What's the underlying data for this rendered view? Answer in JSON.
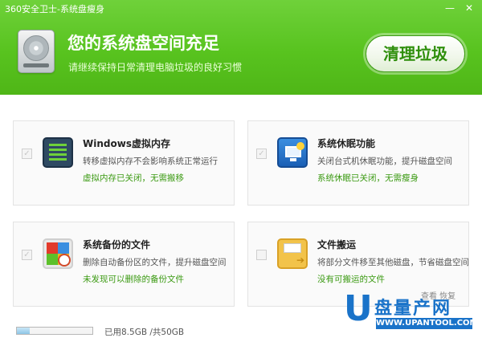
{
  "window": {
    "title": "360安全卫士-系统盘瘦身",
    "minimize_glyph": "—",
    "close_glyph": "✕"
  },
  "header": {
    "icon": "hard-disk-icon",
    "title": "您的系统盘空间充足",
    "subtitle": "请继续保持日常清理电脑垃圾的良好习惯",
    "clean_button": "清理垃圾"
  },
  "cards": [
    {
      "title": "Windows虚拟内存",
      "description": "转移虚拟内存不会影响系统正常运行",
      "status": "虚拟内存已关闭，无需搬移",
      "icon": "virtual-memory-icon",
      "checked": false
    },
    {
      "title": "系统休眠功能",
      "description": "关闭台式机休眠功能，提升磁盘空间",
      "status": "系统休眠已关闭，无需瘦身",
      "icon": "sleep-monitor-icon",
      "checked": false
    },
    {
      "title": "系统备份的文件",
      "description": "删除自动备份区的文件，提升磁盘空间",
      "status": "未发现可以删除的备份文件",
      "icon": "backup-files-icon",
      "checked": false
    },
    {
      "title": "文件搬运",
      "description": "将部分文件移至其他磁盘，节省磁盘空间",
      "status": "没有可搬运的文件",
      "icon": "move-files-icon",
      "checked": false
    }
  ],
  "footer": {
    "usage_text": "已用8.5GB /共50GB",
    "used_fraction": 0.17,
    "links": "查看   恢复"
  },
  "watermark": {
    "letter": "U",
    "brand": "盘量产网",
    "url": "WWW.UPANTOOL.COM"
  },
  "colors": {
    "header_green": "#58c31f",
    "status_green": "#3b9a12",
    "watermark_blue": "#1a73c9"
  }
}
